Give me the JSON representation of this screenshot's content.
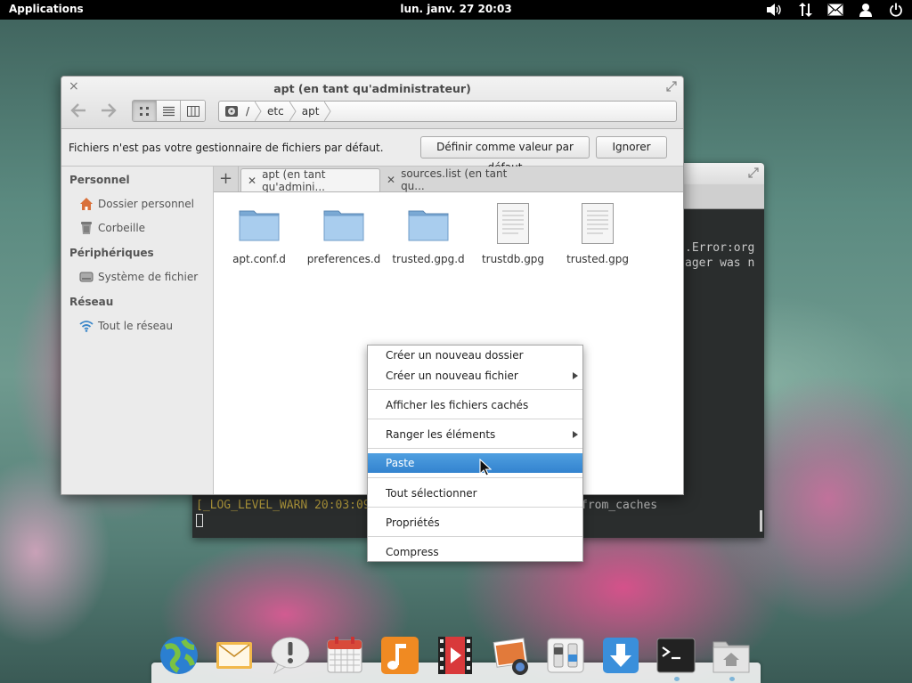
{
  "top_panel": {
    "applications": "Applications",
    "clock": "lun. janv. 27 20:03"
  },
  "terminal": {
    "line1": ".Error:org",
    "line2": "ager was n",
    "warn": "[_LOG_LEVEL_WARN 20:03:09",
    "tail": "from_caches"
  },
  "files_window": {
    "title": "apt (en tant qu'administrateur)",
    "breadcrumbs": [
      "/",
      "etc",
      "apt"
    ],
    "infobar": {
      "message": "Fichiers n'est pas votre gestionnaire de fichiers par défaut.",
      "set_default": "Définir comme valeur par défaut",
      "ignore": "Ignorer"
    },
    "sidebar": {
      "personal_header": "Personnel",
      "home": "Dossier personnel",
      "trash": "Corbeille",
      "devices_header": "Périphériques",
      "filesystem": "Système de fichier",
      "network_header": "Réseau",
      "entire_network": "Tout le réseau"
    },
    "tabs": [
      "apt (en tant qu'admini...",
      "sources.list (en tant qu..."
    ],
    "files": [
      {
        "name": "apt.conf.d",
        "type": "folder"
      },
      {
        "name": "preferences.d",
        "type": "folder"
      },
      {
        "name": "trusted.gpg.d",
        "type": "folder"
      },
      {
        "name": "trustdb.gpg",
        "type": "document"
      },
      {
        "name": "trusted.gpg",
        "type": "document"
      }
    ]
  },
  "context_menu": {
    "items": [
      "Créer un nouveau dossier",
      "Créer un nouveau fichier",
      "Afficher les fichiers cachés",
      "Ranger les éléments",
      "Paste",
      "Tout sélectionner",
      "Propriétés",
      "Compress"
    ],
    "highlighted": "Paste"
  },
  "dock": {
    "apps": [
      "web-browser-icon",
      "mail-icon",
      "notifications-icon",
      "calendar-icon",
      "music-icon",
      "videos-icon",
      "photos-icon",
      "system-settings-icon",
      "app-center-icon",
      "terminal-icon",
      "files-icon"
    ]
  },
  "colors": {
    "accent": "#3a8bd6",
    "panel": "#000000",
    "folder": "#8cbbe3"
  }
}
